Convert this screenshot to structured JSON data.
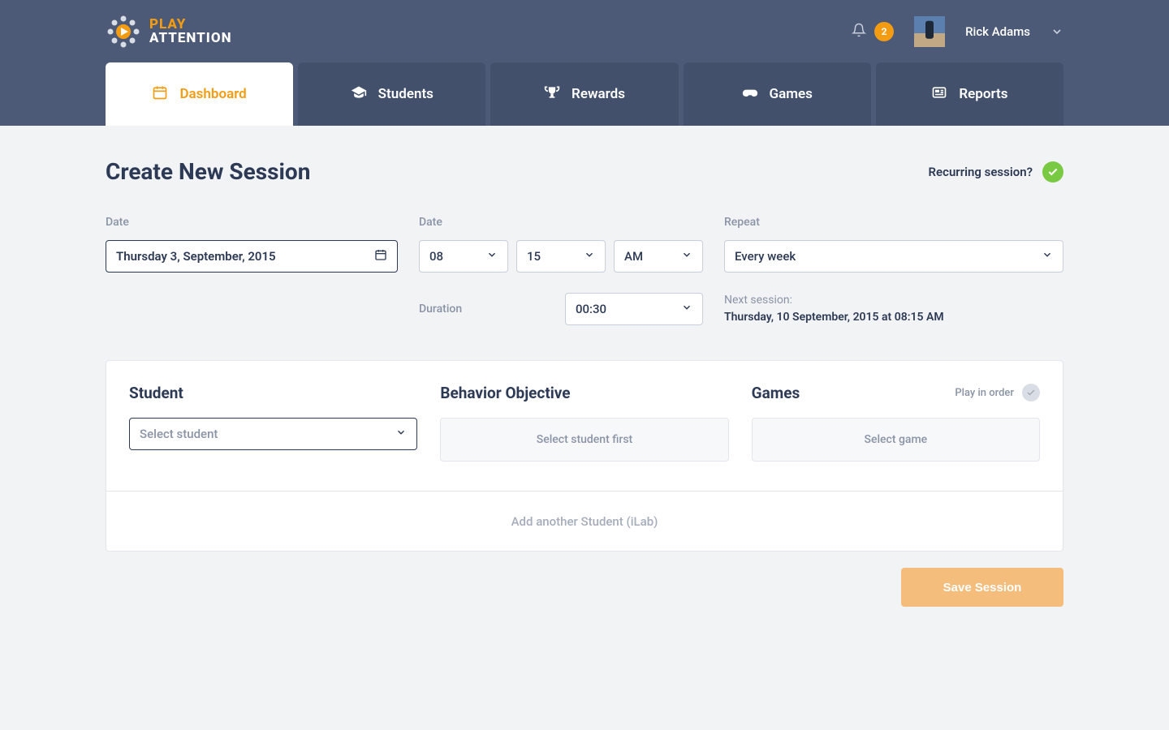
{
  "brand": {
    "line1": "PLAY",
    "line2": "ATTENTION"
  },
  "header": {
    "notification_count": "2",
    "user_name": "Rick Adams"
  },
  "nav": [
    {
      "label": "Dashboard",
      "icon": "calendar",
      "active": true
    },
    {
      "label": "Students",
      "icon": "grad-cap",
      "active": false
    },
    {
      "label": "Rewards",
      "icon": "trophy",
      "active": false
    },
    {
      "label": "Games",
      "icon": "gamepad",
      "active": false
    },
    {
      "label": "Reports",
      "icon": "news",
      "active": false
    }
  ],
  "page": {
    "title": "Create New Session",
    "recurring_label": "Recurring session?",
    "recurring_on": true
  },
  "fields": {
    "date_label": "Date",
    "date_value": "Thursday 3, September, 2015",
    "time_label": "Date",
    "hour": "08",
    "minute": "15",
    "meridiem": "AM",
    "repeat_label": "Repeat",
    "repeat_value": "Every week",
    "duration_label": "Duration",
    "duration_value": "00:30",
    "next_label": "Next session:",
    "next_value": "Thursday, 10 September, 2015 at 08:15 AM"
  },
  "panel": {
    "student_heading": "Student",
    "student_placeholder": "Select student",
    "behavior_heading": "Behavior Objective",
    "behavior_placeholder": "Select student first",
    "games_heading": "Games",
    "games_placeholder": "Select game",
    "play_order_label": "Play in order",
    "add_another": "Add another Student (iLab)"
  },
  "actions": {
    "save": "Save Session"
  },
  "colors": {
    "accent_orange": "#f39c12",
    "header_bg": "#4c5a77",
    "tab_bg": "#42506c",
    "success": "#7ac943"
  }
}
